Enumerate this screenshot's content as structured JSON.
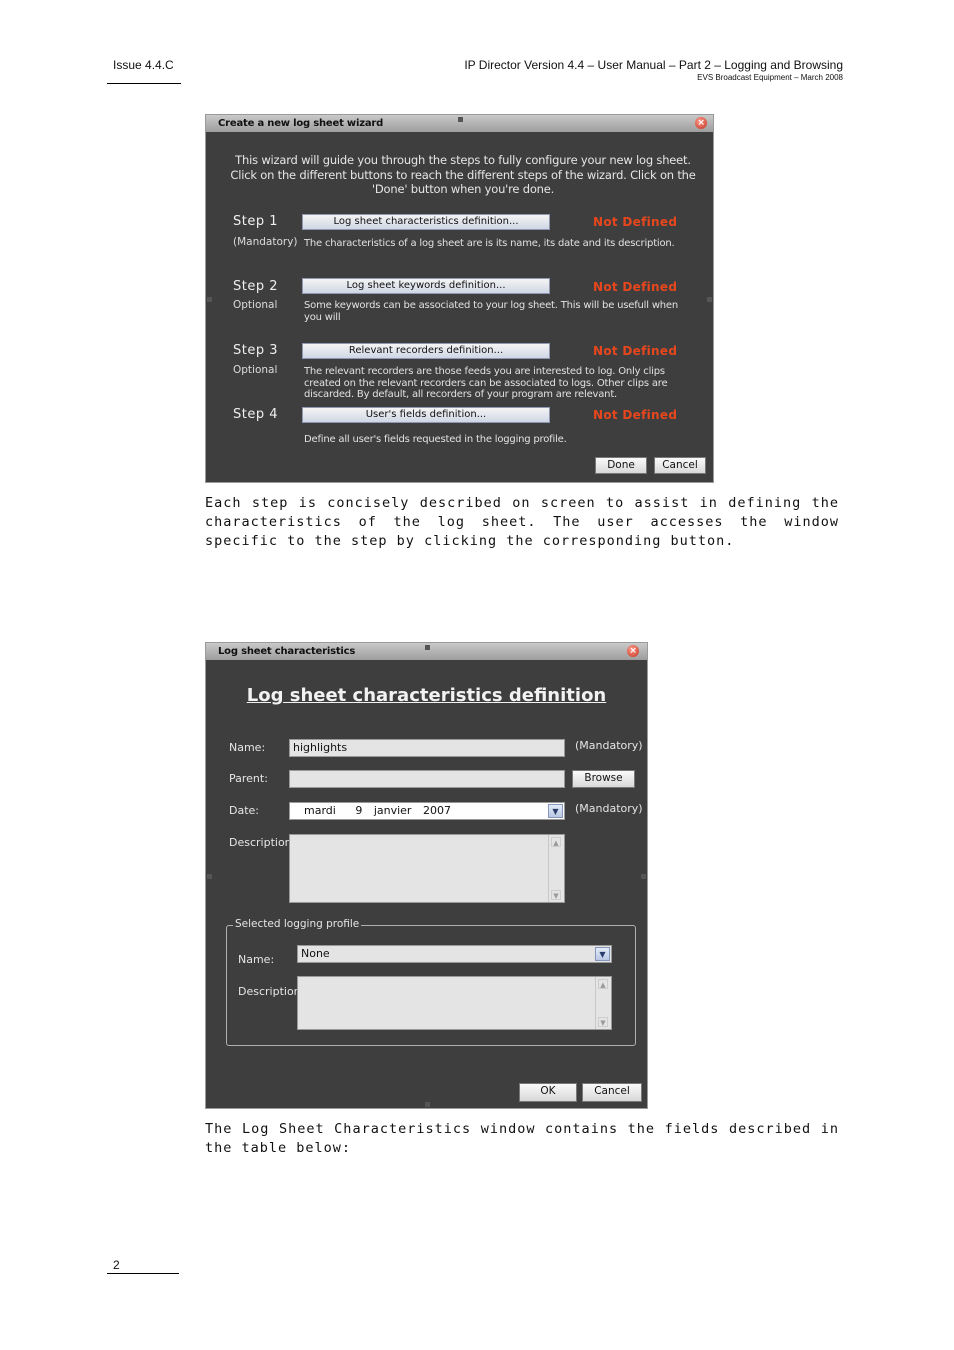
{
  "header": {
    "issue": "Issue 4.4.C",
    "title": "IP Director Version 4.4 – User Manual – Part 2 – Logging and Browsing",
    "subtitle": "EVS Broadcast Equipment – March 2008"
  },
  "wizard": {
    "title": "Create a new log sheet wizard",
    "intro": "This wizard will guide you through the steps to fully configure your new log sheet. Click on the different buttons to reach the different steps of the wizard. Click on the 'Done' button when you're done.",
    "steps": [
      {
        "title": "Step 1",
        "sub": "(Mandatory)",
        "button": "Log sheet characteristics definition...",
        "state": "Not Defined",
        "desc": "The characteristics of a log sheet are is its name, its date and its description."
      },
      {
        "title": "Step 2",
        "sub": "Optional",
        "button": "Log sheet keywords definition...",
        "state": "Not Defined",
        "desc": "Some keywords can be associated to your log sheet. This will be usefull when you will"
      },
      {
        "title": "Step 3",
        "sub": "Optional",
        "button": "Relevant recorders definition...",
        "state": "Not Defined",
        "desc": "The relevant recorders are those feeds you are interested to log. Only clips created on the relevant recorders can be associated to logs. Other clips are discarded. By default, all recorders of your program are relevant."
      },
      {
        "title": "Step 4",
        "sub": "",
        "button": "User's fields definition...",
        "state": "Not Defined",
        "desc": "Define all user's fields requested in the logging profile."
      }
    ],
    "done": "Done",
    "cancel": "Cancel"
  },
  "para1": "Each step is concisely described on screen to assist in defining the characteristics of the log sheet. The user accesses the window specific to the step by clicking the corresponding button.",
  "charDialog": {
    "title": "Log sheet characteristics",
    "heading": "Log sheet characteristics definition",
    "nameLabel": "Name:",
    "nameValue": "highlights",
    "mandatory": "(Mandatory)",
    "parentLabel": "Parent:",
    "browse": "Browse",
    "dateLabel": "Date:",
    "dateDay": "mardi",
    "dateNum": "9",
    "dateMonth": "janvier",
    "dateYear": "2007",
    "descLabel": "Description:",
    "profile": {
      "legend": "Selected logging profile",
      "nameLabel": "Name:",
      "nameValue": "None",
      "descLabel": "Description:"
    },
    "ok": "OK",
    "cancel": "Cancel"
  },
  "para2": "The Log Sheet Characteristics window contains the fields described in the table below:",
  "footer": {
    "page": "2"
  }
}
